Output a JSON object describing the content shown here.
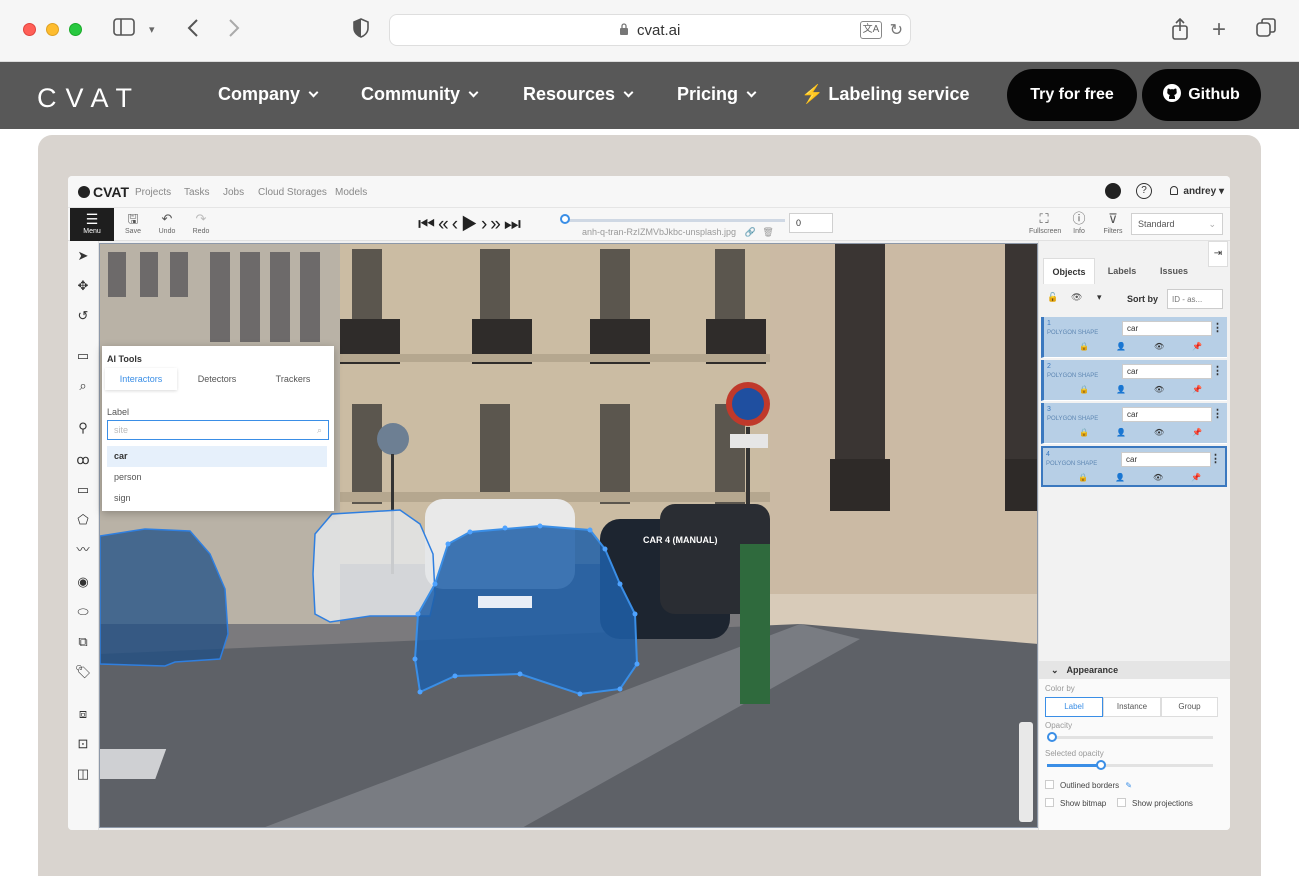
{
  "browser": {
    "url": "cvat.ai"
  },
  "site_nav": {
    "logo": "CVAT",
    "items": [
      "Company",
      "Community",
      "Resources",
      "Pricing"
    ],
    "labeling_service": "⚡ Labeling service",
    "try_button": "Try for free",
    "github_button": "Github"
  },
  "app": {
    "logo": "CVAT",
    "nav_links": [
      "Projects",
      "Tasks",
      "Jobs",
      "Cloud Storages",
      "Models"
    ],
    "user": "andrey",
    "toolbar": {
      "menu": "Menu",
      "save": "Save",
      "undo": "Undo",
      "redo": "Redo",
      "frame_name": "anh-q-tran-RzIZMVbJkbc-unsplash.jpg",
      "frame_number": "0",
      "fullscreen": "Fullscreen",
      "info": "Info",
      "filters": "Filters",
      "workspace": "Standard"
    },
    "ai_tools": {
      "title": "AI Tools",
      "tabs": [
        "Interactors",
        "Detectors",
        "Trackers"
      ],
      "label_caption": "Label",
      "input_value": "site",
      "options": [
        "car",
        "person",
        "sign"
      ]
    },
    "canvas_label": "CAR 4 (MANUAL)",
    "sidebar": {
      "tabs": [
        "Objects",
        "Labels",
        "Issues"
      ],
      "sort_by": "Sort by",
      "sort_value": "ID - as...",
      "objects": [
        {
          "id": "1",
          "shape": "POLYGON SHAPE",
          "label": "car"
        },
        {
          "id": "2",
          "shape": "POLYGON SHAPE",
          "label": "car"
        },
        {
          "id": "3",
          "shape": "POLYGON SHAPE",
          "label": "car"
        },
        {
          "id": "4",
          "shape": "POLYGON SHAPE",
          "label": "car"
        }
      ],
      "appearance": {
        "title": "Appearance",
        "color_by": "Color by",
        "color_options": [
          "Label",
          "Instance",
          "Group"
        ],
        "opacity": "Opacity",
        "selected_opacity": "Selected opacity",
        "outlined_borders": "Outlined borders",
        "show_bitmap": "Show bitmap",
        "show_projections": "Show projections"
      }
    }
  },
  "colors": {
    "site_nav_bg": "#585858",
    "accent": "#3a8ee6",
    "polygon": "#1f5fa8"
  }
}
